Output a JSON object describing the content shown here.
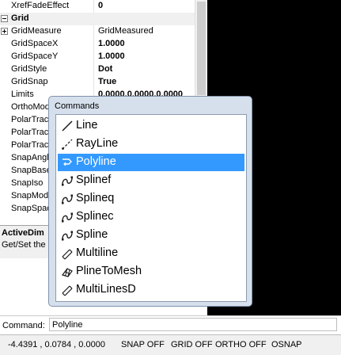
{
  "properties": {
    "rows": [
      {
        "name": "XrefFadeEffect",
        "value": "0",
        "bold": true
      },
      {
        "name": "Grid",
        "value": "",
        "header": true,
        "expander": "minus"
      },
      {
        "name": "GridMeasure",
        "value": "GridMeasured",
        "bold": false,
        "expander": "plus"
      },
      {
        "name": "GridSpaceX",
        "value": "1.0000",
        "bold": true
      },
      {
        "name": "GridSpaceY",
        "value": "1.0000",
        "bold": true
      },
      {
        "name": "GridStyle",
        "value": "Dot",
        "bold": true
      },
      {
        "name": "GridSnap",
        "value": "True",
        "bold": true
      },
      {
        "name": "Limits",
        "value": "0.0000,0.0000,0.0000",
        "bold": true
      },
      {
        "name": "OrthoMode",
        "value": "",
        "bold": false
      },
      {
        "name": "PolarTrack",
        "value": "",
        "bold": false
      },
      {
        "name": "PolarTrack",
        "value": "",
        "bold": false
      },
      {
        "name": "PolarTrack",
        "value": "",
        "bold": false
      },
      {
        "name": "SnapAngle",
        "value": "",
        "bold": false
      },
      {
        "name": "SnapBase",
        "value": "",
        "bold": false
      },
      {
        "name": "SnapIso",
        "value": "",
        "bold": false
      },
      {
        "name": "SnapMode",
        "value": "",
        "bold": false
      },
      {
        "name": "SnapSpac",
        "value": "",
        "bold": false
      }
    ],
    "description": {
      "title": "ActiveDim",
      "text": "Get/Set the"
    }
  },
  "popup": {
    "title": "Commands",
    "selected_index": 2,
    "items": [
      {
        "label": "Line",
        "icon": "line-icon"
      },
      {
        "label": "RayLine",
        "icon": "rayline-icon"
      },
      {
        "label": "Polyline",
        "icon": "polyline-icon"
      },
      {
        "label": "Splinef",
        "icon": "spline-icon"
      },
      {
        "label": "Splineq",
        "icon": "spline-icon"
      },
      {
        "label": "Splinec",
        "icon": "spline-icon"
      },
      {
        "label": "Spline",
        "icon": "spline-icon"
      },
      {
        "label": "Multiline",
        "icon": "multiline-icon"
      },
      {
        "label": "PlineToMesh",
        "icon": "plinetomesh-icon"
      },
      {
        "label": "MultiLinesD",
        "icon": "multiline-icon"
      }
    ]
  },
  "command_line": {
    "label": "Command:",
    "value": "Polyline"
  },
  "status_bar": {
    "coords": "-4.4391 , 0.0784 , 0.0000",
    "snap": "SNAP OFF",
    "grid": "GRID OFF",
    "ortho": "ORTHO OFF",
    "osnap": "OSNAP"
  },
  "colors": {
    "selection": "#3399ff",
    "drawing_area": "#000000",
    "popup_frame": "#d6e0ec"
  }
}
